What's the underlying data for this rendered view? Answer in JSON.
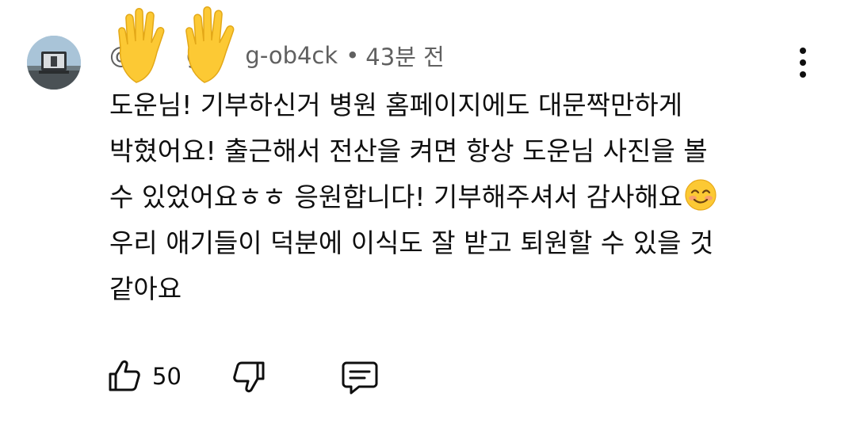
{
  "comment": {
    "author_visible_fragment": "@",
    "author_fragment_2": "g",
    "author_fragment_3": "g-ob4ck",
    "separator": "•",
    "time": "43분 전",
    "lines": [
      "도운님! 기부하신거 병원 홈페이지에도 대문짝만하게",
      "박혔어요! 출근해서 전산을 켜면 항상 도운님 사진을 볼",
      "수 있었어요ㅎㅎ 응원합니다! 기부해주셔서 감사해요",
      "우리 애기들이 덕분에 이식도 잘 받고 퇴원할 수 있을 것",
      "같아요"
    ],
    "trailing_emoji": "smiling-face-emoji",
    "overlay_emoji": "raised-hands-emoji"
  },
  "actions": {
    "like_count": "50",
    "like_icon": "thumbs-up-icon",
    "dislike_icon": "thumbs-down-icon",
    "reply_icon": "comment-reply-icon"
  },
  "menu": {
    "icon": "more-vert-icon"
  },
  "colors": {
    "text": "#0f0f0f",
    "meta": "#606060",
    "emoji_yellow": "#fcc934"
  }
}
